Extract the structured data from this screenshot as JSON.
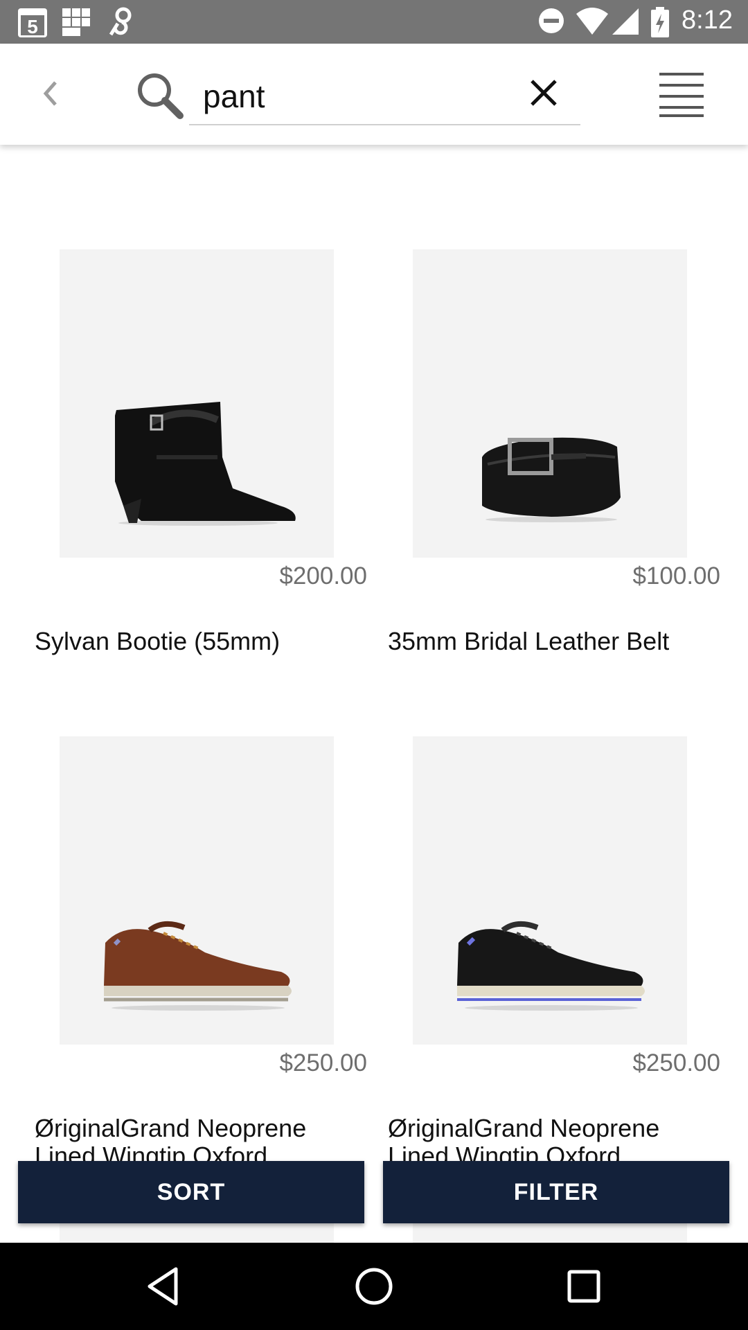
{
  "status_bar": {
    "time": "8:12",
    "icons": [
      "calendar-5-icon",
      "grid-app-icon",
      "link-app-icon",
      "do-not-disturb-icon",
      "wifi-icon",
      "signal-icon",
      "battery-charging-icon"
    ]
  },
  "header": {
    "back_icon": "chevron-left-icon",
    "search_icon": "search-icon",
    "search_value": "pant",
    "clear_icon": "close-icon",
    "menu_icon": "hamburger-menu-icon"
  },
  "products": [
    {
      "name": "Sylvan Bootie (55mm)",
      "price": "$200.00",
      "image": "black-ankle-bootie"
    },
    {
      "name": "35mm Bridal Leather Belt",
      "price": "$100.00",
      "image": "black-leather-belt"
    },
    {
      "name": "ØriginalGrand Neoprene Lined Wingtip Oxford",
      "price": "$250.00",
      "image": "brown-wingtip-oxford"
    },
    {
      "name": "ØriginalGrand Neoprene Lined Wingtip Oxford",
      "price": "$250.00",
      "image": "black-wingtip-oxford"
    }
  ],
  "actions": {
    "sort_label": "SORT",
    "filter_label": "FILTER"
  },
  "nav_bar": {
    "icons": [
      "back-triangle-icon",
      "home-circle-icon",
      "recents-square-icon"
    ]
  },
  "colors": {
    "status_bar": "#757575",
    "button_bg": "#13213a",
    "image_bg": "#f3f3f3",
    "price": "#6e6e6e"
  }
}
